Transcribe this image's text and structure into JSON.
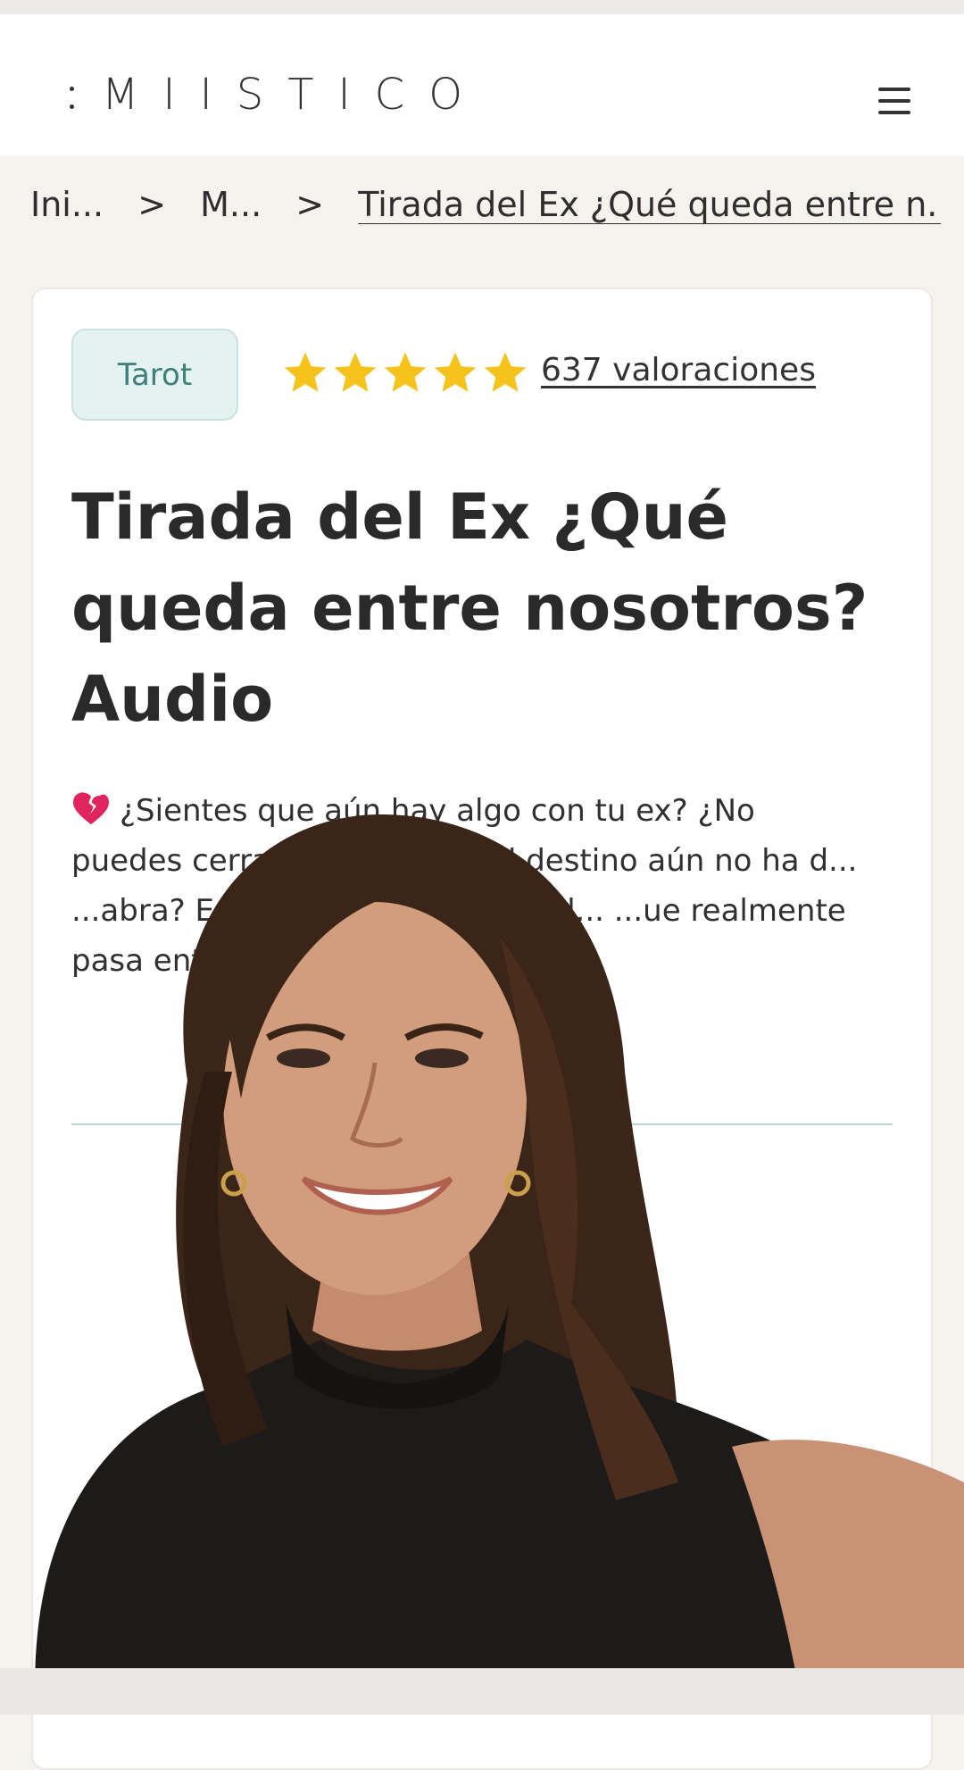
{
  "header": {
    "logo_text": "MIISTICO",
    "menu_icon": "hamburger-menu-icon"
  },
  "breadcrumb": {
    "items": [
      "Ini...",
      "M...",
      "Tirada del Ex ¿Qué queda entre n..."
    ],
    "separator": ">"
  },
  "card": {
    "tag_label": "Tarot",
    "rating_stars": 5,
    "ratings_text": "637 valoraciones",
    "title": "Tirada del Ex ¿Qué queda entre nosotros? Audio",
    "description": "¿Sientes que aún hay algo con tu ex? ¿No puedes cerrar ... crees que el destino aún no ha d... ...abra? Esta lectura de tarot te d... ...ue realmente pasa entre vo..."
  },
  "colors": {
    "accent_teal": "#3f7f7a",
    "star_yellow": "#f6c21c",
    "page_bg": "#f6f3ef"
  }
}
